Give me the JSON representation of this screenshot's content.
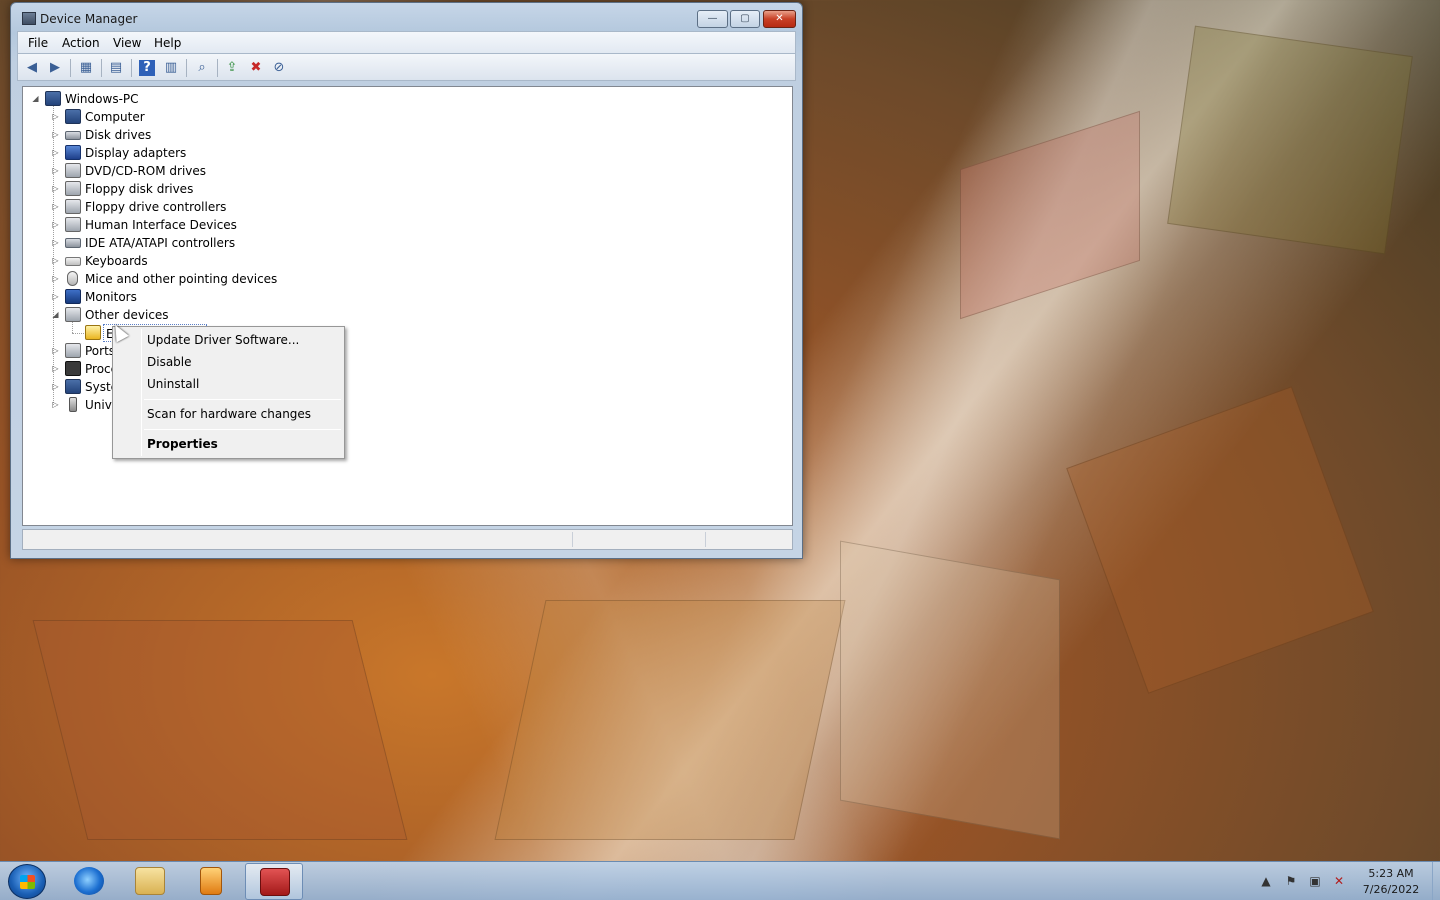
{
  "window": {
    "title": "Device Manager",
    "controls": {
      "minimize": "—",
      "maximize": "▢",
      "close": "✕"
    }
  },
  "menubar": {
    "items": [
      "File",
      "Action",
      "View",
      "Help"
    ]
  },
  "toolbar": {
    "icons": [
      "back-icon",
      "forward-icon",
      "show-hide-console-tree-icon",
      "properties-icon",
      "help-icon",
      "action-pane-icon",
      "scan-hardware-icon",
      "update-driver-icon",
      "uninstall-icon",
      "disable-icon"
    ]
  },
  "tree": {
    "root": "Windows-PC",
    "categories": [
      {
        "label": "Computer",
        "icon": "computer-icon",
        "expanded": false
      },
      {
        "label": "Disk drives",
        "icon": "disk-drive-icon",
        "expanded": false
      },
      {
        "label": "Display adapters",
        "icon": "display-adapter-icon",
        "expanded": false
      },
      {
        "label": "DVD/CD-ROM drives",
        "icon": "dvd-drive-icon",
        "expanded": false
      },
      {
        "label": "Floppy disk drives",
        "icon": "floppy-drive-icon",
        "expanded": false
      },
      {
        "label": "Floppy drive controllers",
        "icon": "floppy-controller-icon",
        "expanded": false
      },
      {
        "label": "Human Interface Devices",
        "icon": "hid-icon",
        "expanded": false
      },
      {
        "label": "IDE ATA/ATAPI controllers",
        "icon": "ide-controller-icon",
        "expanded": false
      },
      {
        "label": "Keyboards",
        "icon": "keyboard-icon",
        "expanded": false
      },
      {
        "label": "Mice and other pointing devices",
        "icon": "mouse-icon",
        "expanded": false
      },
      {
        "label": "Monitors",
        "icon": "monitor-icon",
        "expanded": false
      },
      {
        "label": "Other devices",
        "icon": "other-devices-icon",
        "expanded": true
      },
      {
        "label": "Ports",
        "icon": "ports-icon",
        "expanded": false
      },
      {
        "label": "Proce",
        "icon": "processor-icon",
        "expanded": false
      },
      {
        "label": "Syste",
        "icon": "system-devices-icon",
        "expanded": false
      },
      {
        "label": "Unive",
        "icon": "usb-controller-icon",
        "expanded": false
      }
    ],
    "child_under_other_devices": {
      "label": "E",
      "icon": "unknown-device-warning-icon",
      "selected": true
    }
  },
  "context_menu": {
    "items": [
      {
        "label": "Update Driver Software...",
        "bold": false
      },
      {
        "label": "Disable",
        "bold": false
      },
      {
        "label": "Uninstall",
        "bold": false
      },
      {
        "label": "Scan for hardware changes",
        "bold": false
      },
      {
        "label": "Properties",
        "bold": true
      }
    ]
  },
  "taskbar": {
    "pinned": [
      "internet-explorer-icon",
      "windows-explorer-icon",
      "media-player-icon",
      "device-manager-icon"
    ],
    "active": "device-manager-icon",
    "tray_icons": [
      "show-hidden-icons-icon",
      "action-center-flag-icon",
      "network-icon",
      "volume-muted-icon"
    ],
    "clock": {
      "time": "5:23 AM",
      "date": "7/26/2022"
    }
  }
}
